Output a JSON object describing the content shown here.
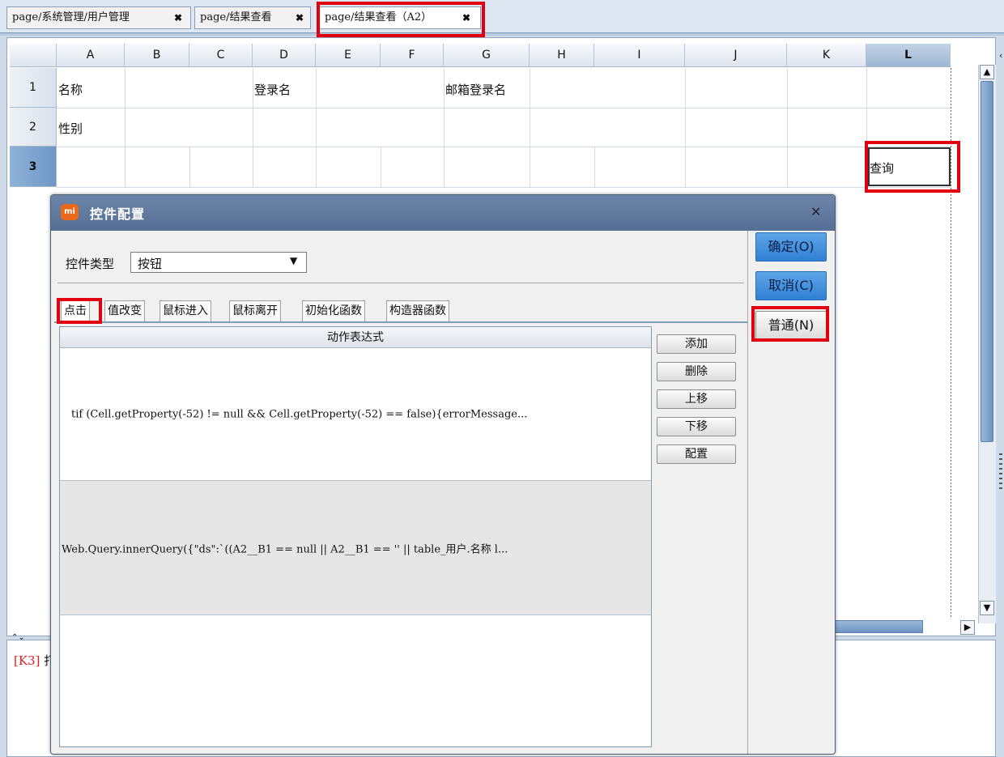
{
  "tabs": [
    {
      "label": "page/系统管理/用户管理",
      "close": "✖",
      "active": false
    },
    {
      "label": "page/结果查看",
      "close": "✖",
      "active": false
    },
    {
      "label": "page/结果查看（A2）",
      "close": "✖",
      "active": true
    }
  ],
  "sheet": {
    "columns": [
      "A",
      "B",
      "C",
      "D",
      "E",
      "F",
      "G",
      "H",
      "I",
      "J",
      "K",
      "L"
    ],
    "selected_column": "L",
    "rows": [
      "1",
      "2",
      "3"
    ],
    "selected_row": "3",
    "cells": {
      "A1": "名称",
      "D1": "登录名",
      "G1": "邮箱登录名",
      "A2": "性别",
      "L3": "查询"
    }
  },
  "dialog": {
    "title": "控件配置",
    "logo_text": "mi",
    "close": "✕",
    "control_type_label": "控件类型",
    "control_type_value": "按钮",
    "event_tabs": [
      "点击",
      "值改变",
      "鼠标进入",
      "鼠标离开",
      "初始化函数",
      "构造器函数"
    ],
    "active_event_tab": "点击",
    "list_header": "动作表达式",
    "actions": [
      "tif (Cell.getProperty(-52) != null && Cell.getProperty(-52) == false){errorMessage...",
      "Web.Query.innerQuery({\"ds\":`((A2__B1 == null  || A2__B1 == ''  || table_用户.名称 l..."
    ],
    "side_buttons": [
      "添加",
      "删除",
      "上移",
      "下移",
      "配置"
    ],
    "ok_label": "确定(O)",
    "cancel_label": "取消(C)",
    "normal_label": "普通(N)"
  },
  "log": {
    "first_line_prefix": "[K3]",
    "first_line_rest": "打"
  },
  "colors": {
    "highlight": "#e00010",
    "title_bar": "#566f94",
    "primary_button": "#2f7fd3",
    "log_prefix": "#e02020"
  }
}
